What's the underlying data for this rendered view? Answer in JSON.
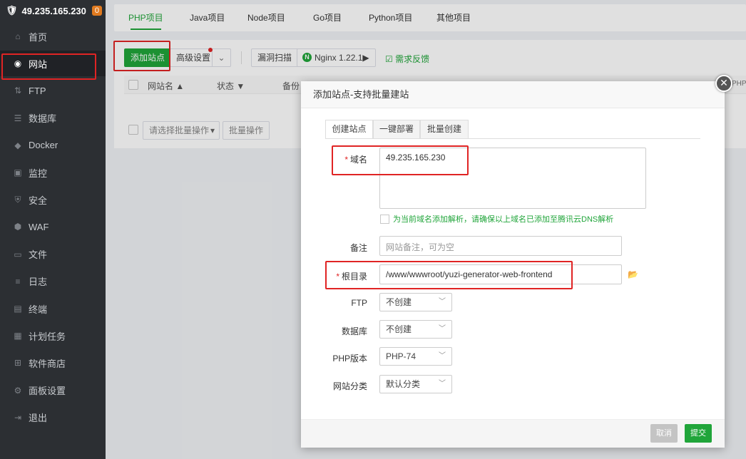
{
  "sidebar": {
    "server_ip": "49.235.165.230",
    "badge": "0",
    "items": [
      {
        "label": "首页",
        "icon": "home-icon"
      },
      {
        "label": "网站",
        "icon": "globe-icon"
      },
      {
        "label": "FTP",
        "icon": "ftp-icon"
      },
      {
        "label": "数据库",
        "icon": "database-icon"
      },
      {
        "label": "Docker",
        "icon": "docker-icon"
      },
      {
        "label": "监控",
        "icon": "monitor-icon"
      },
      {
        "label": "安全",
        "icon": "shield-icon"
      },
      {
        "label": "WAF",
        "icon": "waf-icon"
      },
      {
        "label": "文件",
        "icon": "folder-icon"
      },
      {
        "label": "日志",
        "icon": "log-icon"
      },
      {
        "label": "终端",
        "icon": "terminal-icon"
      },
      {
        "label": "计划任务",
        "icon": "calendar-icon"
      },
      {
        "label": "软件商店",
        "icon": "grid-icon"
      },
      {
        "label": "面板设置",
        "icon": "gear-icon"
      },
      {
        "label": "退出",
        "icon": "logout-icon"
      }
    ]
  },
  "project_tabs": [
    "PHP项目",
    "Java项目",
    "Node项目",
    "Go项目",
    "Python项目",
    "其他项目"
  ],
  "toolbar": {
    "add_site": "添加站点",
    "advanced": "高级设置",
    "vuln_scan": "漏洞扫描",
    "nginx": "Nginx 1.22.1▶",
    "feedback": "需求反馈"
  },
  "table": {
    "col_name": "网站名 ▲",
    "col_status": "状态 ▼",
    "col_note": "备份"
  },
  "batch": {
    "placeholder": "请选择批量操作",
    "button": "批量操作"
  },
  "dialog": {
    "title": "添加站点-支持批量建站",
    "tabs": [
      "创建站点",
      "一键部署",
      "批量创建"
    ],
    "domain_label": "域名",
    "domain_value": "49.235.165.230",
    "dns_hint": "为当前域名添加解析，请确保以上域名已添加至腾讯云DNS解析",
    "note_label": "备注",
    "note_placeholder": "网站备注，可为空",
    "root_label": "根目录",
    "root_value": "/www/wwwroot/yuzi-generator-web-frontend",
    "ftp_label": "FTP",
    "ftp_value": "不创建",
    "db_label": "数据库",
    "db_value": "不创建",
    "php_label": "PHP版本",
    "php_value": "PHP-74",
    "category_label": "网站分类",
    "category_value": "默认分类",
    "cancel": "取消",
    "submit": "提交",
    "side_clip": "PHP"
  },
  "colors": {
    "accent": "#20a53a",
    "highlight": "#e02424",
    "sidebar": "#2c2f33"
  }
}
